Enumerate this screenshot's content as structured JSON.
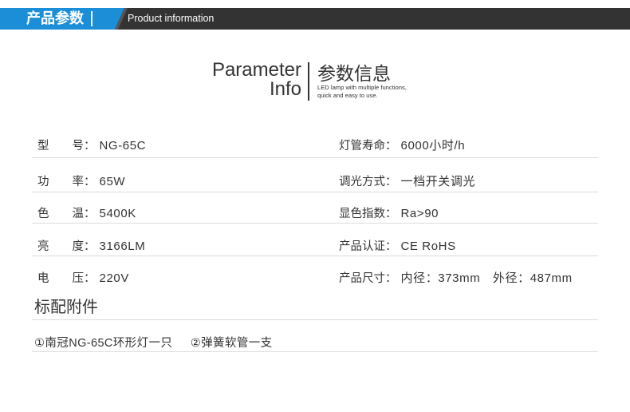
{
  "header": {
    "title": "产品参数",
    "subtitle": "Product information",
    "colors": {
      "accent": "#1c8ed8",
      "bar": "#333333",
      "rule": "#dcdcdc"
    }
  },
  "section_title": {
    "en_line1": "Parameter",
    "en_line2": "Info",
    "zh": "参数信息",
    "desc_line1": "LED lamp with multiple functions,",
    "desc_line2": "quick and easy to use."
  },
  "params": {
    "rows": [
      {
        "left": {
          "label": [
            "型",
            "号："
          ],
          "value": "NG-65C"
        },
        "right": {
          "label": "灯管寿命：",
          "value": "6000小时/h"
        }
      },
      {
        "left": {
          "label": [
            "功",
            "率："
          ],
          "value": "65W"
        },
        "right": {
          "label": "调光方式：",
          "value": "一档开关调光"
        }
      },
      {
        "left": {
          "label": [
            "色",
            "温："
          ],
          "value": "5400K"
        },
        "right": {
          "label": "显色指数：",
          "value": "Ra>90"
        }
      },
      {
        "left": {
          "label": [
            "亮",
            "度："
          ],
          "value": "3166LM"
        },
        "right": {
          "label": "产品认证：",
          "value": "CE RoHS"
        }
      },
      {
        "left": {
          "label": [
            "电",
            "压："
          ],
          "value": "220V"
        },
        "right": {
          "label": "产品尺寸：",
          "value": "内径：373mm　外径：487mm"
        }
      }
    ]
  },
  "accessories": {
    "title": "标配附件",
    "items": [
      "①南冠NG-65C环形灯一只",
      "②弹簧软管一支"
    ]
  }
}
